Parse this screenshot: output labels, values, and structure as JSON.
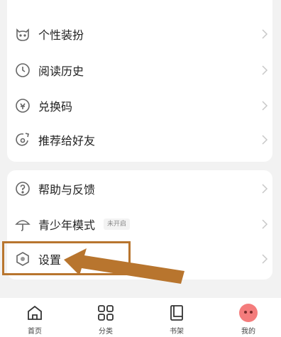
{
  "menu_top": [
    {
      "label": "个性装扮",
      "icon": "cat-face-icon"
    },
    {
      "label": "阅读历史",
      "icon": "clock-icon"
    },
    {
      "label": "兑换码",
      "icon": "redeem-icon"
    },
    {
      "label": "推荐给好友",
      "icon": "share-icon"
    }
  ],
  "menu_bottom": [
    {
      "label": "帮助与反馈",
      "icon": "question-icon"
    },
    {
      "label": "青少年模式",
      "icon": "umbrella-icon",
      "badge": "未开启"
    },
    {
      "label": "设置",
      "icon": "hexagon-settings-icon"
    }
  ],
  "tabbar": [
    {
      "label": "首页",
      "icon": "home-icon"
    },
    {
      "label": "分类",
      "icon": "grid-icon"
    },
    {
      "label": "书架",
      "icon": "book-icon"
    },
    {
      "label": "我的",
      "icon": "avatar-icon"
    }
  ],
  "colors": {
    "highlight": "#b8752e",
    "avatar": "#f47c7c"
  }
}
